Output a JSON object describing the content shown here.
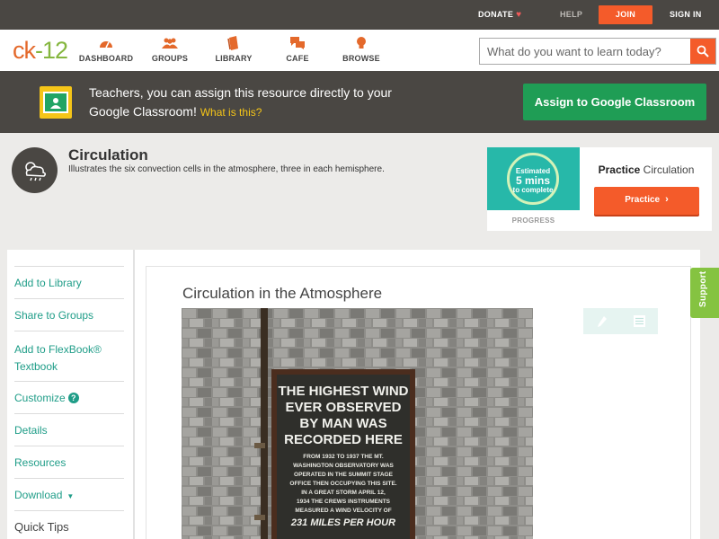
{
  "topbar": {
    "donate": "DONATE",
    "help": "HELP",
    "join": "JOIN",
    "signin": "SIGN IN"
  },
  "nav": {
    "logo_part1": "ck",
    "logo_part2": "-12",
    "dashboard": "DASHBOARD",
    "groups": "GROUPS",
    "library": "LIBRARY",
    "cafe": "CAFE",
    "browse": "BROWSE",
    "search_placeholder": "What do you want to learn today?"
  },
  "classroom_banner": {
    "text": "Teachers, you can assign this resource directly to your Google Classroom!",
    "what_is_this": "What is this?",
    "assign_button": "Assign to Google Classroom"
  },
  "concept": {
    "title": "Circulation",
    "description": "Illustrates the six convection cells in the atmosphere, three in each hemisphere."
  },
  "practice": {
    "estimated": "Estimated",
    "minutes": "5 mins",
    "to_complete": "to complete",
    "progress": "PROGRESS",
    "label_bold": "Practice",
    "label_rest": "Circulation",
    "button": "Practice"
  },
  "sidebar": {
    "items": [
      {
        "label": "Add to Library"
      },
      {
        "label": "Share to Groups"
      },
      {
        "label": "Add to FlexBook® Textbook"
      },
      {
        "label": "Customize"
      },
      {
        "label": "Details"
      },
      {
        "label": "Resources"
      },
      {
        "label": "Download"
      },
      {
        "label": "Quick Tips"
      }
    ],
    "customize_badge": "?"
  },
  "article": {
    "title": "Circulation in the Atmosphere",
    "sign_lines": [
      "THE HIGHEST WIND",
      "EVER OBSERVED",
      "BY MAN WAS",
      "RECORDED HERE"
    ],
    "sign_small": [
      "FROM 1932 TO 1937 THE MT.",
      "WASHINGTON OBSERVATORY WAS",
      "OPERATED IN THE SUMMIT STAGE",
      "OFFICE THEN OCCUPYING THIS SITE.",
      "IN A GREAT STORM APRIL 12,",
      "1934 THE CREWS INSTRUMENTS",
      "MEASURED A WIND VELOCITY OF"
    ],
    "sign_speed": "231 MILES PER HOUR"
  },
  "support": "Support",
  "colors": {
    "accent_orange": "#f45b2a",
    "accent_green": "#1f9d55",
    "link_teal": "#1f9d88",
    "dark_bar": "#4a4743",
    "support_green": "#85c341"
  }
}
